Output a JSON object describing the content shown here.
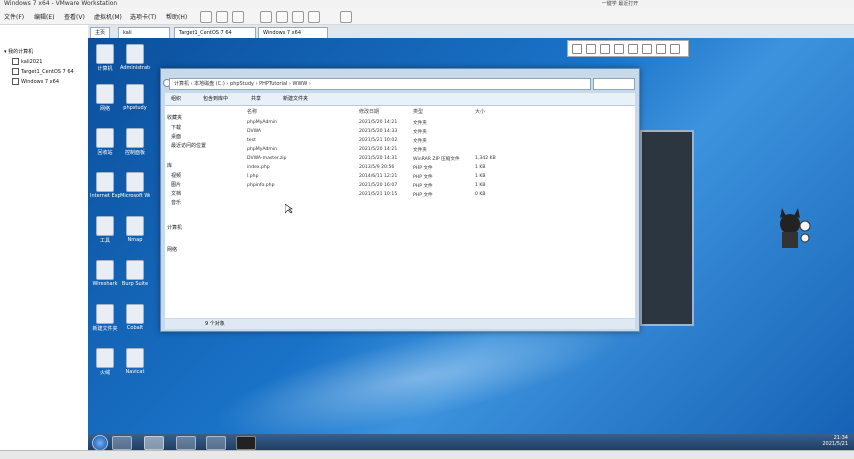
{
  "host": {
    "title": "Windows 7 x64 - VMware Workstation",
    "center_caption": "一键学 最近打开",
    "menu": [
      "文件(F)",
      "编辑(E)",
      "查看(V)",
      "虚拟机(M)",
      "选项卡(T)",
      "帮助(H)"
    ]
  },
  "tabs": [
    {
      "label": "主页"
    },
    {
      "label": "kali"
    },
    {
      "label": "Target1_CentOS 7 64"
    },
    {
      "label": "Windows 7 x64"
    }
  ],
  "library": {
    "title": "我的计算机",
    "items": [
      "kali2021",
      "Target1_CentOS 7 64",
      "Windows 7 x64"
    ]
  },
  "desktop_icons": [
    {
      "label": "计算机"
    },
    {
      "label": "Administrator"
    },
    {
      "label": "网络"
    },
    {
      "label": "phpstudy"
    },
    {
      "label": "回收站"
    },
    {
      "label": "控制面板"
    },
    {
      "label": "Internet Explorer"
    },
    {
      "label": "Microsoft Word"
    },
    {
      "label": "工具"
    },
    {
      "label": "Nmap"
    },
    {
      "label": "Wireshark"
    },
    {
      "label": "Burp Suite"
    },
    {
      "label": "新建文件夹"
    },
    {
      "label": "Cobalt"
    },
    {
      "label": "火绒"
    },
    {
      "label": "Navicat"
    }
  ],
  "explorer": {
    "address": "计算机 › 本地磁盘 (C:) › phpStudy › PHPTutorial › WWW ›",
    "toolbar": [
      "组织",
      "包含到库中",
      "共享",
      "新建文件夹"
    ],
    "nav": {
      "favorites_header": "收藏夹",
      "favorites": [
        "下载",
        "桌面",
        "最近访问的位置"
      ],
      "libraries_header": "库",
      "libraries": [
        "视频",
        "图片",
        "文档",
        "音乐"
      ],
      "computer": "计算机",
      "network": "网络"
    },
    "columns": [
      "名称",
      "修改日期",
      "类型",
      "大小"
    ],
    "files": [
      {
        "name": "phpMyAdmin",
        "date": "2021/5/20 14:21",
        "type": "文件夹",
        "size": ""
      },
      {
        "name": "DVWA",
        "date": "2021/5/20 14:33",
        "type": "文件夹",
        "size": ""
      },
      {
        "name": "test",
        "date": "2021/5/21 10:02",
        "type": "文件夹",
        "size": ""
      },
      {
        "name": "phpMyAdmin",
        "date": "2021/5/20 14:21",
        "type": "文件夹",
        "size": ""
      },
      {
        "name": "DVWA-master.zip",
        "date": "2021/5/20 14:31",
        "type": "WinRAR ZIP 压缩文件",
        "size": "1,342 KB"
      },
      {
        "name": "index.php",
        "date": "2013/5/9 20:56",
        "type": "PHP 文件",
        "size": "1 KB"
      },
      {
        "name": "l.php",
        "date": "2014/6/11 12:21",
        "type": "PHP 文件",
        "size": "1 KB"
      },
      {
        "name": "phpinfo.php",
        "date": "2021/5/20 16:07",
        "type": "PHP 文件",
        "size": "1 KB"
      },
      {
        "name": "",
        "date": "2021/5/21 10:15",
        "type": "PHP 文件",
        "size": "0 KB"
      }
    ],
    "status": "9 个对象"
  },
  "taskbar": {
    "clock_time": "21:34",
    "clock_date": "2021/5/21"
  }
}
